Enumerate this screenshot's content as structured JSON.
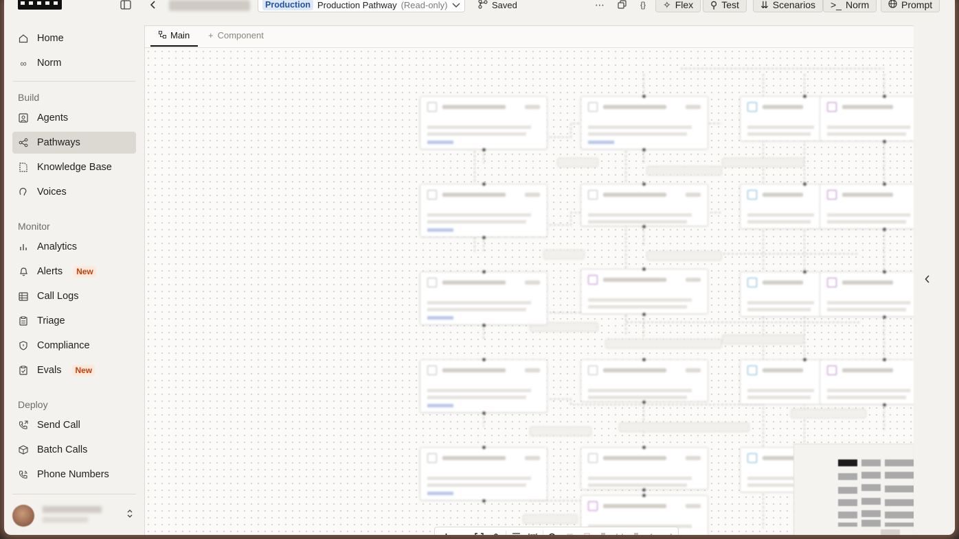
{
  "topbar": {
    "environment_tag": "Production",
    "pathway_name": "Production Pathway",
    "pathway_mode": "(Read-only)",
    "saved_label": "Saved",
    "buttons": [
      "Flex",
      "Test",
      "Scenarios",
      "Norm",
      "Prompt"
    ]
  },
  "sidebar": {
    "items": [
      {
        "label": "Home",
        "icon": "home-icon"
      },
      {
        "label": "Norm",
        "icon": "norm-icon"
      }
    ],
    "build_label": "Build",
    "build_items": [
      {
        "label": "Agents",
        "icon": "agent-icon"
      },
      {
        "label": "Pathways",
        "icon": "share-icon",
        "active": true
      },
      {
        "label": "Knowledge Base",
        "icon": "file-icon"
      },
      {
        "label": "Voices",
        "icon": "voice-icon"
      }
    ],
    "monitor_label": "Monitor",
    "monitor_items": [
      {
        "label": "Analytics",
        "icon": "bar-chart-icon"
      },
      {
        "label": "Alerts",
        "icon": "bell-icon",
        "badge": "New"
      },
      {
        "label": "Call Logs",
        "icon": "table-icon"
      },
      {
        "label": "Triage",
        "icon": "clipboard-icon"
      },
      {
        "label": "Compliance",
        "icon": "shield-icon"
      },
      {
        "label": "Evals",
        "icon": "clipboard-check-icon",
        "badge": "New"
      }
    ],
    "deploy_label": "Deploy",
    "deploy_items": [
      {
        "label": "Send Call",
        "icon": "phone-outgoing-icon"
      },
      {
        "label": "Batch Calls",
        "icon": "box-icon"
      },
      {
        "label": "Phone Numbers",
        "icon": "phone-icon"
      }
    ]
  },
  "tabs": {
    "main": "Main",
    "add": "Component"
  }
}
